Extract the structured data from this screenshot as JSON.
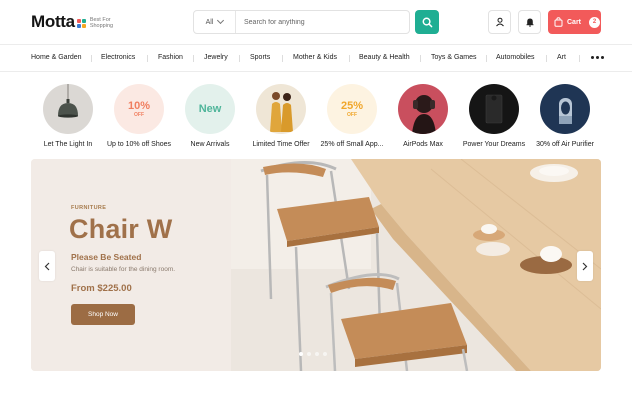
{
  "brand": {
    "name": "Motta",
    "tagline_line1": "Best For",
    "tagline_line2": "Shopping",
    "dot_colors": [
      "#f25a5a",
      "#1fae93",
      "#3a7bd5",
      "#f5a623"
    ]
  },
  "search": {
    "category": "All",
    "placeholder": "Search for anything",
    "button_icon": "search-icon"
  },
  "header_icons": [
    "user-icon",
    "bell-icon"
  ],
  "cart": {
    "label": "Cart",
    "count": "2",
    "icon": "bag-icon"
  },
  "nav": {
    "items": [
      "Home & Garden",
      "Electronics",
      "Fashion",
      "Jewelry",
      "Sports",
      "Mother & Kids",
      "Beauty & Health",
      "Toys & Games",
      "Automobiles",
      "Art"
    ],
    "more_icon": "more-dots-icon"
  },
  "categories": [
    {
      "label": "Let The Light In",
      "badge": ""
    },
    {
      "label": "Up to 10% off Shoes",
      "badge": "10%",
      "badge_sub": "OFF"
    },
    {
      "label": "New Arrivals",
      "badge": "New"
    },
    {
      "label": "Limited Time Offer",
      "badge": ""
    },
    {
      "label": "25% off Small App...",
      "badge": "25%",
      "badge_sub": "OFF"
    },
    {
      "label": "AirPods Max",
      "badge": ""
    },
    {
      "label": "Power Your Dreams",
      "badge": ""
    },
    {
      "label": "30% off Air Purifier",
      "badge": ""
    }
  ],
  "hero": {
    "kicker": "FURNITURE",
    "title": "Chair W",
    "subtitle": "Please Be Seated",
    "description": "Chair is suitable for the dining room.",
    "price": "From $225.00",
    "cta": "Shop Now",
    "slides": 4,
    "active_slide": 1
  },
  "colors": {
    "accent": "#1fae93",
    "cart": "#f25a5a",
    "hero_brown": "#a0714a",
    "button_brown": "#9c6c44"
  }
}
